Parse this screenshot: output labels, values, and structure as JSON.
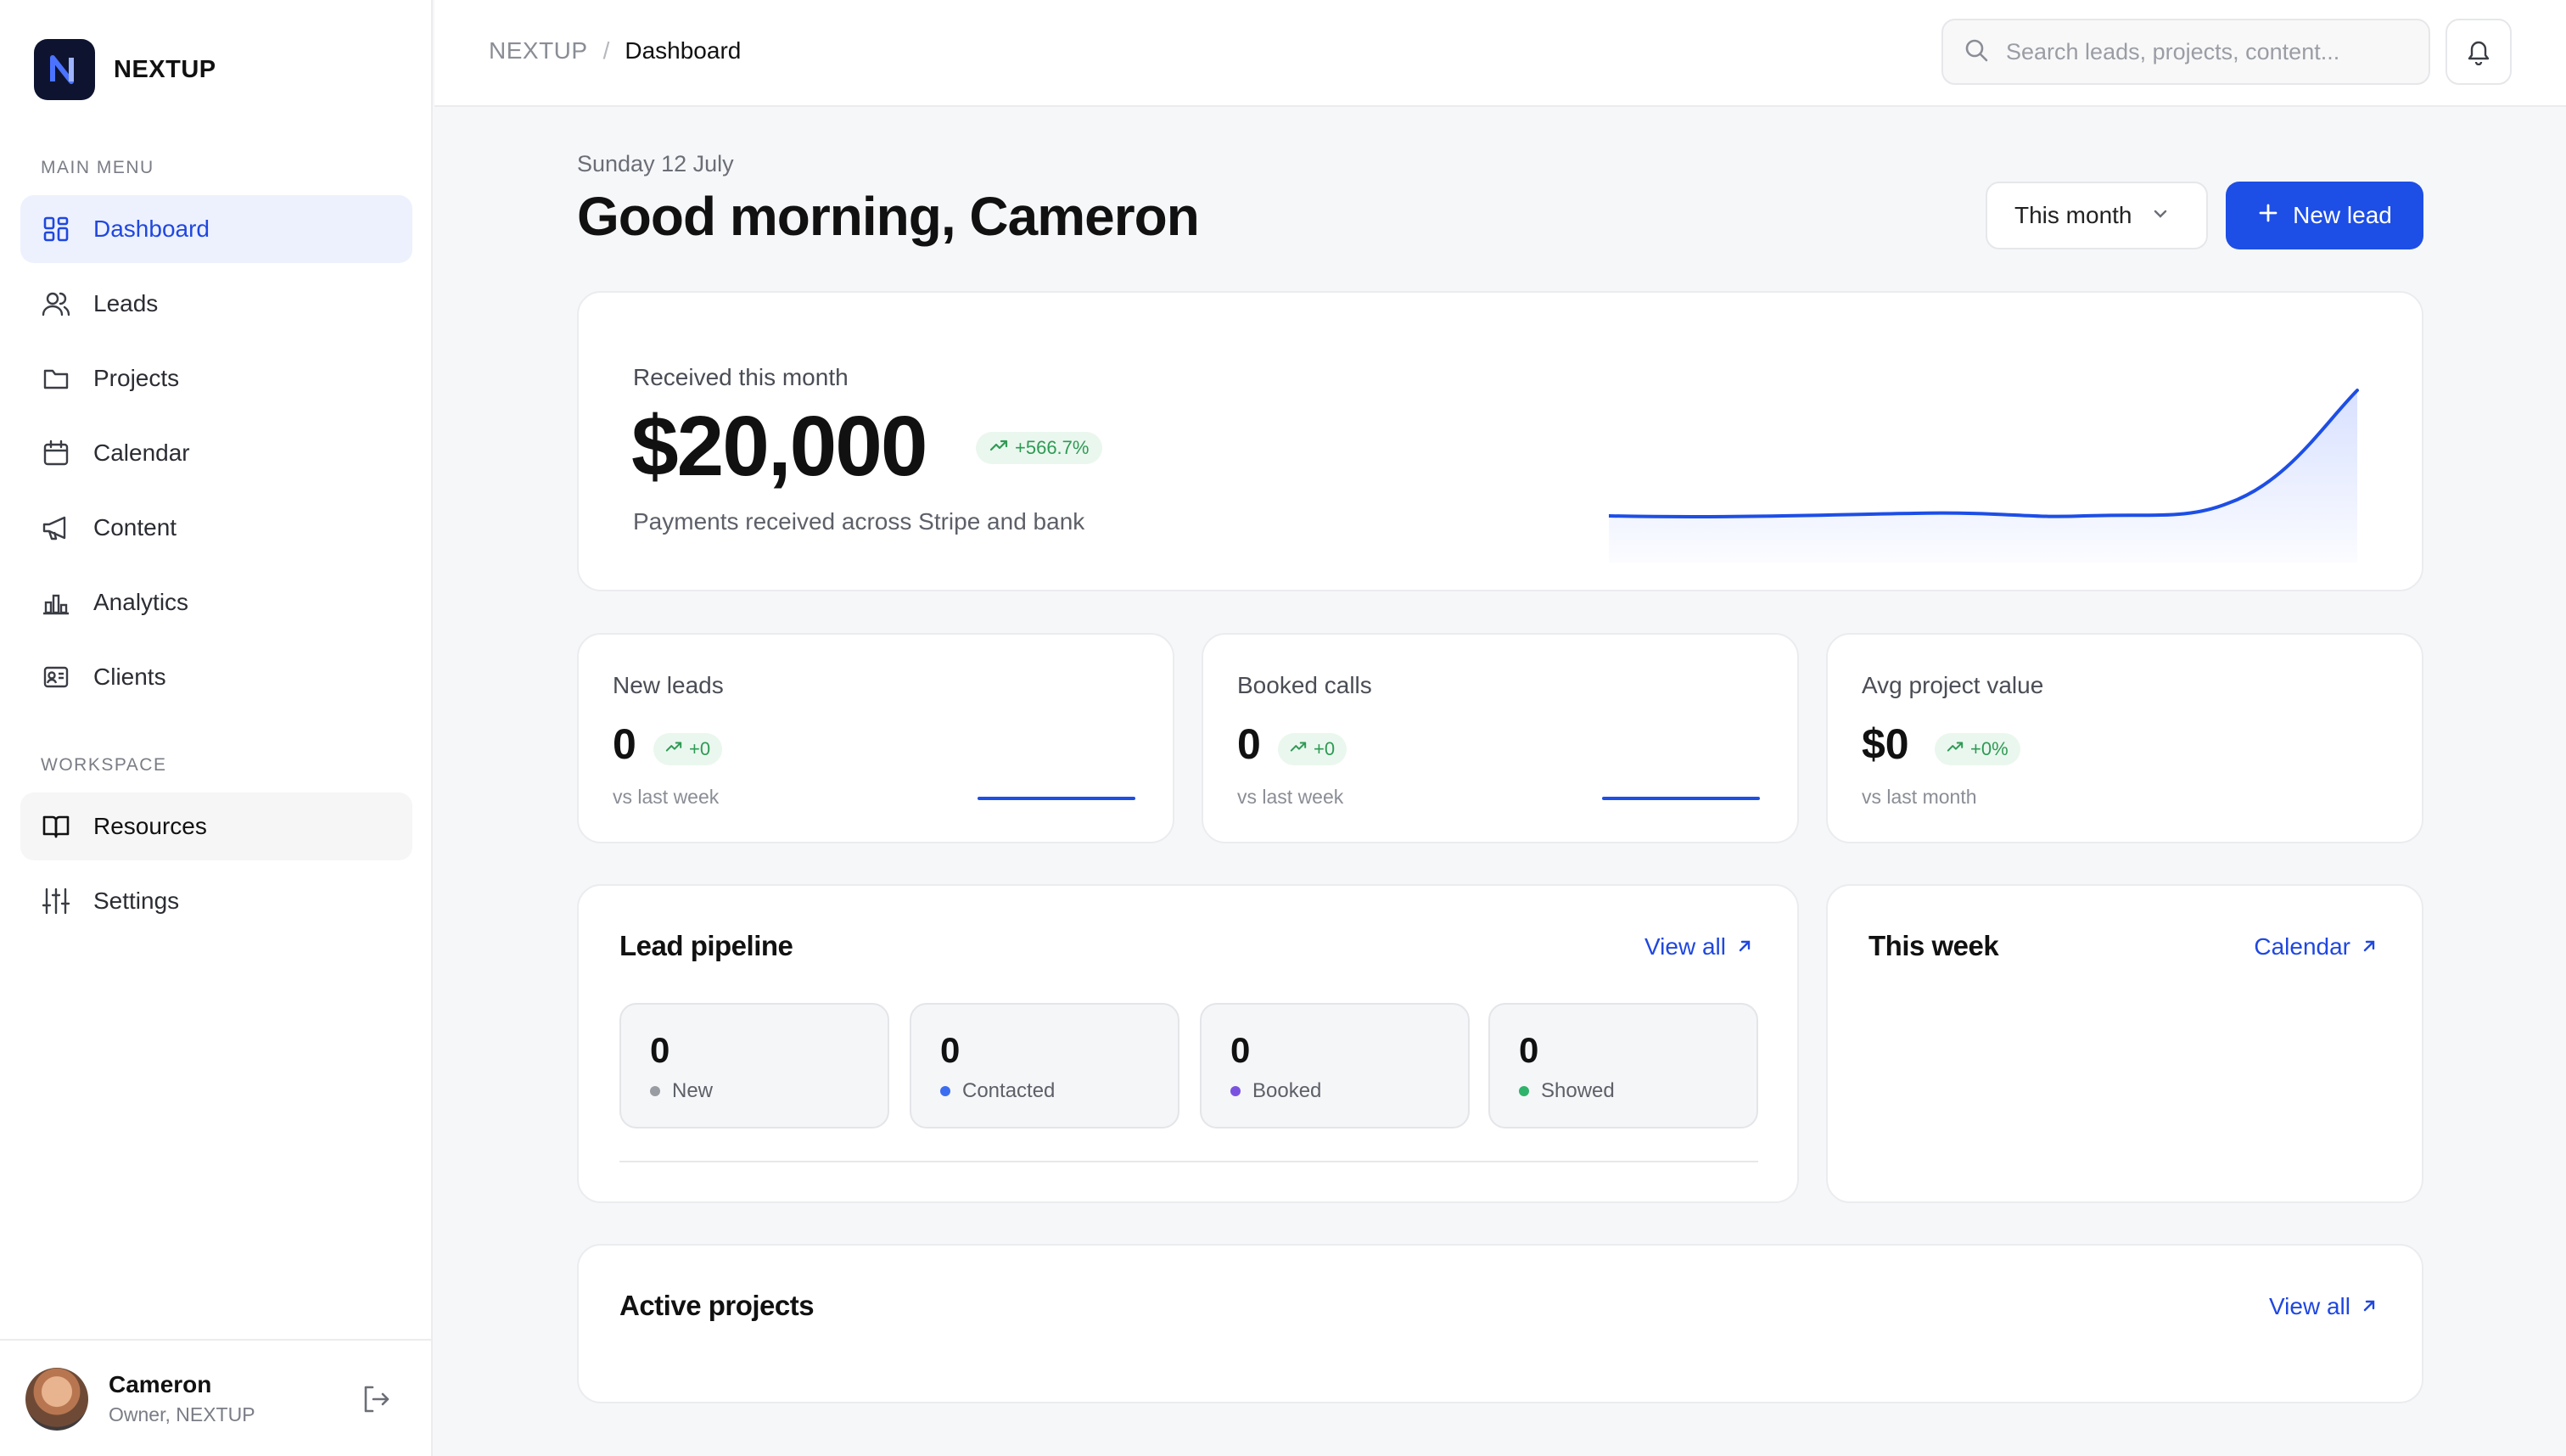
{
  "brand": {
    "name": "NEXTUP",
    "logo_letter": "N"
  },
  "sidebar": {
    "main_menu_label": "MAIN MENU",
    "workspace_label": "WORKSPACE",
    "items": [
      {
        "label": "Dashboard",
        "icon": "dashboard-grid-icon"
      },
      {
        "label": "Leads",
        "icon": "users-icon"
      },
      {
        "label": "Projects",
        "icon": "folder-icon"
      },
      {
        "label": "Calendar",
        "icon": "calendar-icon"
      },
      {
        "label": "Content",
        "icon": "megaphone-icon"
      },
      {
        "label": "Analytics",
        "icon": "bar-chart-icon"
      },
      {
        "label": "Clients",
        "icon": "id-card-icon"
      }
    ],
    "workspace_items": [
      {
        "label": "Resources",
        "icon": "book-open-icon"
      },
      {
        "label": "Settings",
        "icon": "sliders-icon"
      }
    ],
    "user": {
      "name": "Cameron",
      "role": "Owner, NEXTUP"
    }
  },
  "topbar": {
    "breadcrumb_root": "NEXTUP",
    "breadcrumb_sep": "/",
    "breadcrumb_current": "Dashboard",
    "search_placeholder": "Search leads, projects, content..."
  },
  "header": {
    "date": "Sunday 12 July",
    "greeting": "Good morning, Cameron",
    "range_label": "This month",
    "new_lead_label": "New lead"
  },
  "revenue": {
    "label": "Received this month",
    "amount": "$20,000",
    "change": "+566.7%",
    "subtitle": "Payments received across Stripe and bank",
    "line_color": "#1d4ee6"
  },
  "stats": [
    {
      "title": "New leads",
      "value": "0",
      "change": "+0",
      "sub": "vs last week"
    },
    {
      "title": "Booked calls",
      "value": "0",
      "change": "+0",
      "sub": "vs last week"
    },
    {
      "title": "Avg project value",
      "value": "$0",
      "change": "+0%",
      "sub": "vs last month"
    }
  ],
  "pipeline": {
    "title": "Lead pipeline",
    "link": "View all",
    "stages": [
      {
        "count": "0",
        "label": "New",
        "color": "#9a9ca3"
      },
      {
        "count": "0",
        "label": "Contacted",
        "color": "#3b6df0"
      },
      {
        "count": "0",
        "label": "Booked",
        "color": "#7b52e0"
      },
      {
        "count": "0",
        "label": "Showed",
        "color": "#2fb36b"
      }
    ]
  },
  "week": {
    "title": "This week",
    "link": "Calendar"
  },
  "projects": {
    "title": "Active projects",
    "link": "View all"
  },
  "colors": {
    "accent": "#1d4ee6",
    "positive": "#2f9a55"
  }
}
